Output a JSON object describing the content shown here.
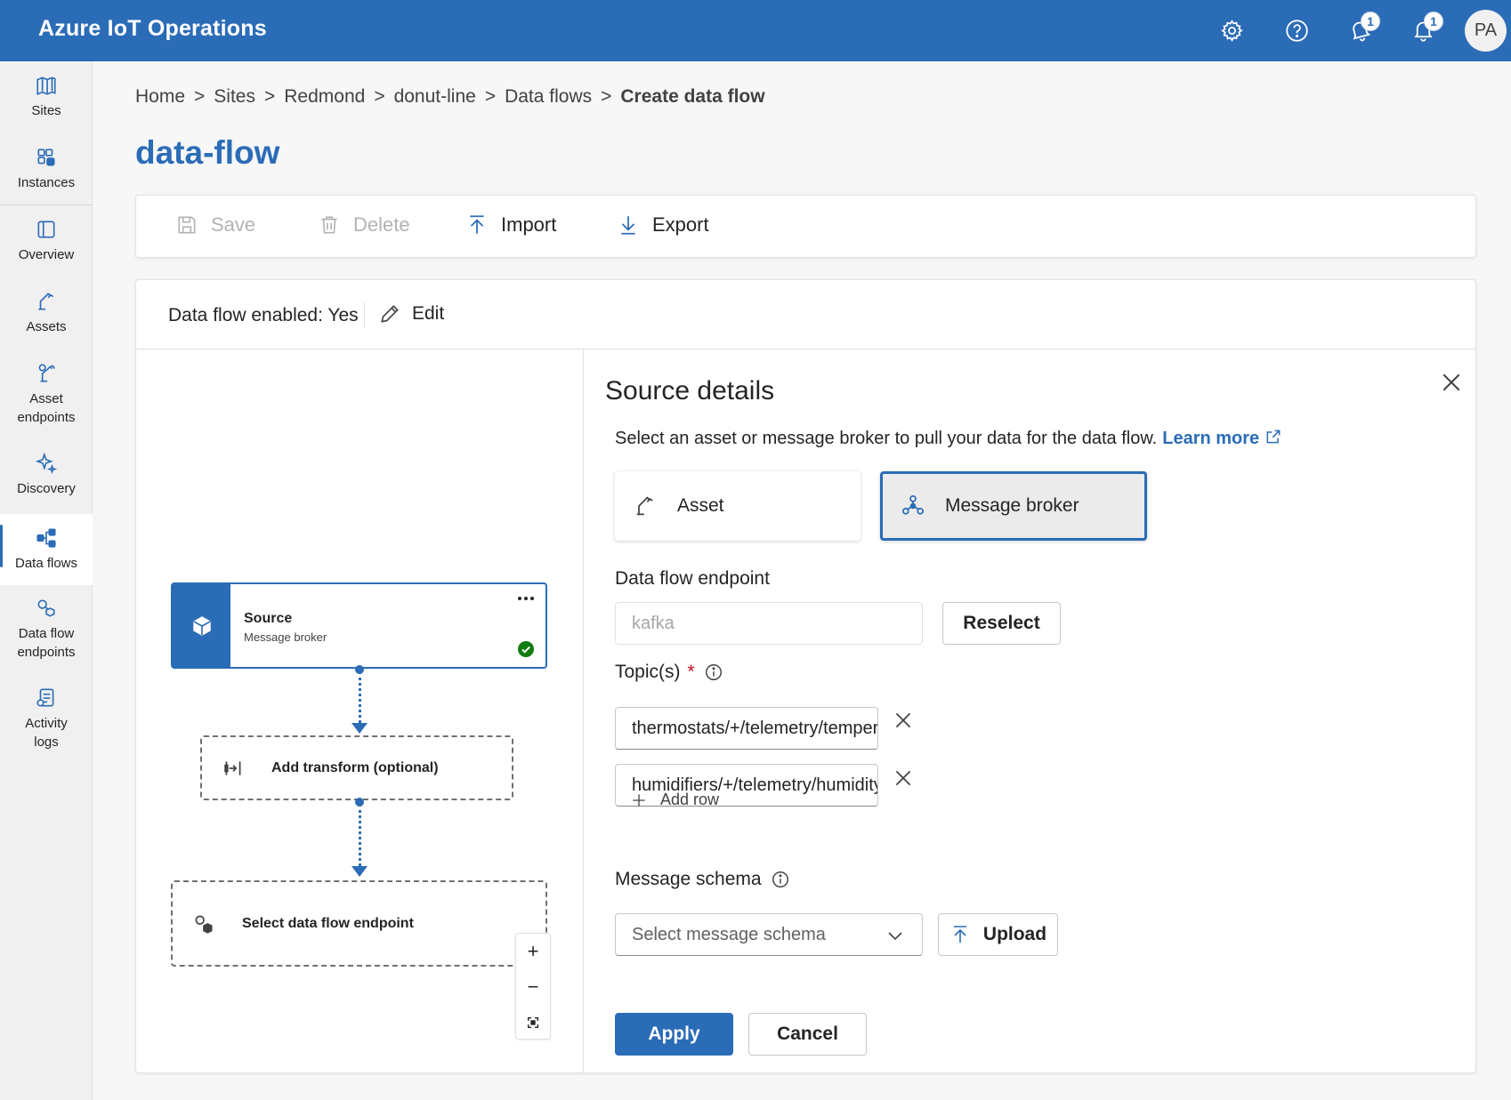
{
  "app": {
    "title": "Azure IoT Operations",
    "avatar_initials": "PA"
  },
  "header": {
    "notifications_badge_1": "1",
    "notifications_badge_2": "1"
  },
  "nav": {
    "items": [
      {
        "label": "Sites"
      },
      {
        "label": "Instances"
      },
      {
        "label": "Overview"
      },
      {
        "label": "Assets"
      },
      {
        "label": "Asset endpoints"
      },
      {
        "label": "Discovery"
      },
      {
        "label": "Data flows"
      },
      {
        "label": "Data flow endpoints"
      },
      {
        "label": "Activity logs"
      }
    ],
    "active": "Data flows"
  },
  "breadcrumb": [
    "Home",
    "Sites",
    "Redmond",
    "donut-line",
    "Data flows",
    "Create data flow"
  ],
  "breadcrumb_sep": ">",
  "page": {
    "title": "data-flow"
  },
  "toolbar": {
    "save": "Save",
    "delete": "Delete",
    "import": "Import",
    "export": "Export"
  },
  "card": {
    "enabled_text": "Data flow enabled: Yes",
    "edit": "Edit"
  },
  "flow": {
    "source_title": "Source",
    "source_sub": "Message broker",
    "transform": "Add transform (optional)",
    "destination": "Select data flow endpoint",
    "zoom_in": "+",
    "zoom_out": "−"
  },
  "details": {
    "title": "Source details",
    "description": "Select an asset or message broker to pull your data for the data flow.",
    "learn_more": "Learn more",
    "choice_asset": "Asset",
    "choice_broker": "Message broker",
    "endpoint_label": "Data flow endpoint",
    "endpoint_value": "kafka",
    "reselect": "Reselect",
    "topics_label": "Topic(s)",
    "required_mark": "*",
    "topics": [
      "thermostats/+/telemetry/temperature",
      "humidifiers/+/telemetry/humidity"
    ],
    "add_row": "Add row",
    "schema_label": "Message schema",
    "schema_placeholder": "Select message schema",
    "upload": "Upload",
    "apply": "Apply",
    "cancel": "Cancel"
  },
  "colors": {
    "brand": "#2b6cb7",
    "success": "#107c10",
    "required": "#c50f1f"
  }
}
